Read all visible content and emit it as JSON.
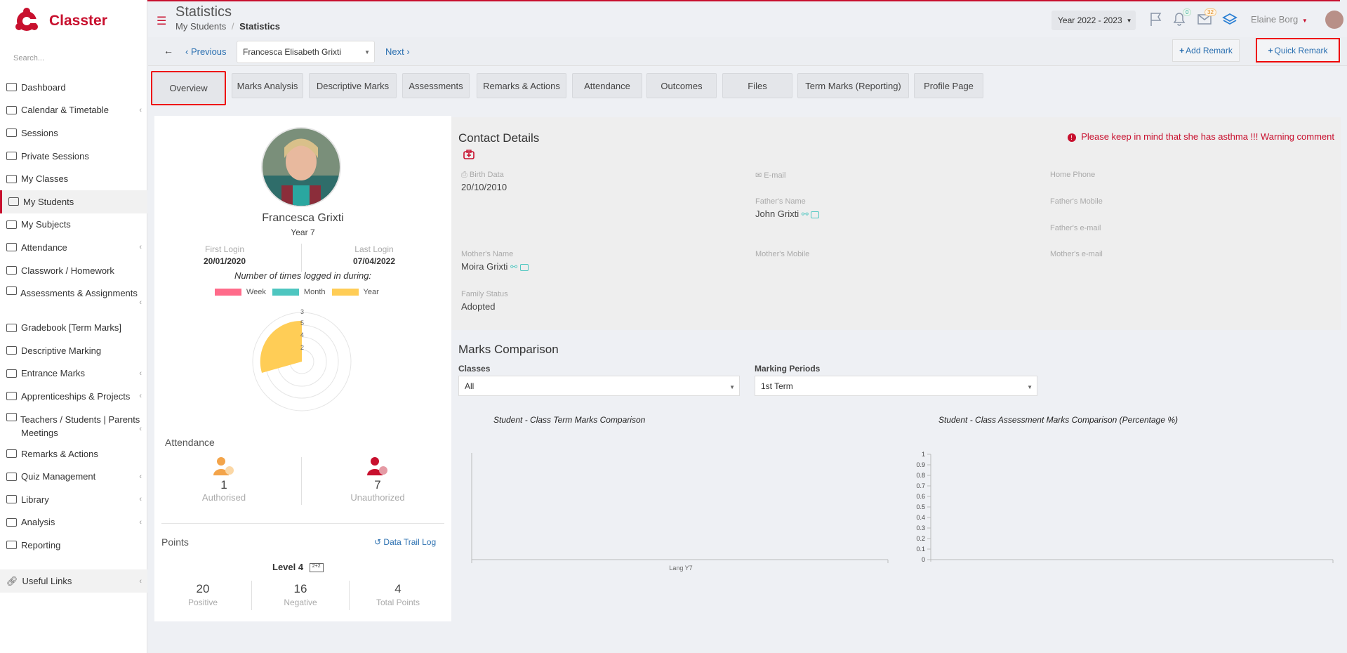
{
  "app": {
    "brand": "Classter",
    "search_placeholder": "Search..."
  },
  "sidebar": {
    "items": [
      {
        "label": "Dashboard",
        "chev": false
      },
      {
        "label": "Calendar & Timetable",
        "chev": true
      },
      {
        "label": "Sessions",
        "chev": false
      },
      {
        "label": "Private Sessions",
        "chev": false
      },
      {
        "label": "My Classes",
        "chev": false
      },
      {
        "label": "My Students",
        "chev": false,
        "active": true
      },
      {
        "label": "My Subjects",
        "chev": false
      },
      {
        "label": "Attendance",
        "chev": true
      },
      {
        "label": "Classwork / Homework",
        "chev": false
      },
      {
        "label": "Assessments & Assignments",
        "chev": true,
        "two": true
      },
      {
        "label": "Gradebook [Term Marks]",
        "chev": false
      },
      {
        "label": "Descriptive Marking",
        "chev": false
      },
      {
        "label": "Entrance Marks",
        "chev": true
      },
      {
        "label": "Apprenticeships & Projects",
        "chev": true
      },
      {
        "label": "Teachers / Students | Parents Meetings",
        "chev": true,
        "two": true
      },
      {
        "label": "Remarks & Actions",
        "chev": false
      },
      {
        "label": "Quiz Management",
        "chev": true
      },
      {
        "label": "Library",
        "chev": true
      },
      {
        "label": "Analysis",
        "chev": true
      },
      {
        "label": "Reporting",
        "chev": false
      }
    ],
    "useful_links": "Useful Links"
  },
  "header": {
    "title": "Statistics",
    "crumb_parent": "My Students",
    "crumb_sep": "/",
    "crumb_current": "Statistics",
    "year": "Year 2022 - 2023",
    "notif_count": "0",
    "msg_count": "32",
    "user": "Elaine Borg"
  },
  "student_bar": {
    "previous": "Previous",
    "student": "Francesca Elisabeth Grixti",
    "next": "Next",
    "add_remark": "Add Remark",
    "quick_remark": "Quick Remark"
  },
  "tabs": [
    "Overview",
    "Marks Analysis",
    "Descriptive Marks",
    "Assessments",
    "Remarks & Actions",
    "Attendance",
    "Outcomes",
    "Files",
    "Term Marks (Reporting)",
    "Profile Page"
  ],
  "profile": {
    "name": "Francesca Grixti",
    "year": "Year 7",
    "first_login_label": "First Login",
    "first_login": "20/01/2020",
    "last_login_label": "Last Login",
    "last_login": "07/04/2022",
    "times_logged": "Number of times logged in during:",
    "legend": [
      {
        "label": "Week",
        "color": "#ff6b8a"
      },
      {
        "label": "Month",
        "color": "#4ec6c0"
      },
      {
        "label": "Year",
        "color": "#ffcd56"
      }
    ],
    "polar_ticks": [
      "3",
      "5",
      "4",
      "2"
    ]
  },
  "attendance": {
    "title": "Attendance",
    "authorised": "1",
    "authorised_label": "Authorised",
    "unauthorized": "7",
    "unauthorized_label": "Unauthorized"
  },
  "points": {
    "title": "Points",
    "data_trail": "Data Trail Log",
    "level": "Level 4",
    "positive": "20",
    "positive_label": "Positive",
    "negative": "16",
    "negative_label": "Negative",
    "total": "4",
    "total_label": "Total Points"
  },
  "contact": {
    "title": "Contact Details",
    "warning": "Please keep in mind that she has asthma !!! Warning comment",
    "birth_label": "Birth Data",
    "birth": "20/10/2010",
    "email_label": "E-mail",
    "home_phone_label": "Home Phone",
    "father_label": "Father's Name",
    "father": "John Grixti",
    "father_mobile_label": "Father's Mobile",
    "father_email_label": "Father's e-mail",
    "mother_label": "Mother's Name",
    "mother": "Moira Grixti",
    "mother_mobile_label": "Mother's Mobile",
    "mother_email_label": "Mother's e-mail",
    "family_label": "Family Status",
    "family": "Adopted"
  },
  "marks": {
    "title": "Marks Comparison",
    "classes_label": "Classes",
    "classes_value": "All",
    "periods_label": "Marking Periods",
    "periods_value": "1st Term"
  },
  "chart_data": [
    {
      "type": "bar",
      "title": "Student - Class Term Marks Comparison",
      "categories": [
        "Lang Y7"
      ],
      "series": []
    },
    {
      "type": "bar",
      "title": "Student - Class Assessment Marks Comparison (Percentage %)",
      "categories": [],
      "series": [],
      "ylim": [
        0,
        1
      ],
      "yticks": [
        "1",
        "0.9",
        "0.8",
        "0.7",
        "0.6",
        "0.5",
        "0.4",
        "0.3",
        "0.2",
        "0.1",
        "0"
      ]
    }
  ]
}
